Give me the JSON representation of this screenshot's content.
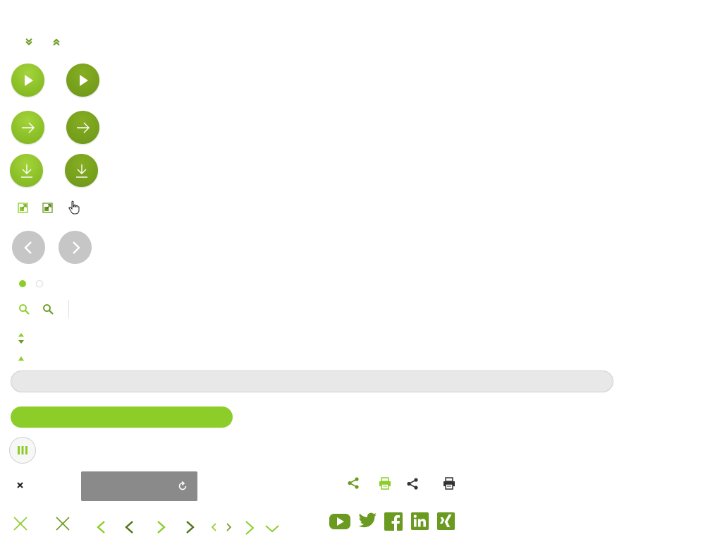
{
  "colors": {
    "brand_green": "#8ccd29",
    "dark_green": "#76a01c",
    "icon_green": "#6a9a1f",
    "grey_button": "#c6c6c6",
    "progress_track": "#e8e8e8",
    "grey_bar": "#8a8a8a"
  },
  "icons": {
    "row1": [
      "double-chevron-down-icon",
      "double-chevron-up-icon"
    ],
    "play_buttons": [
      "play-icon",
      "play-icon"
    ],
    "arrow_buttons": [
      "arrow-right-icon",
      "arrow-right-icon"
    ],
    "download_buttons": [
      "download-icon",
      "download-icon"
    ],
    "external": [
      "external-link-icon",
      "external-link-icon",
      "hand-cursor-icon"
    ],
    "carousel": [
      "chevron-left-icon",
      "chevron-right-icon"
    ],
    "search": [
      "search-icon",
      "search-icon"
    ],
    "sort": [
      "sort-icon",
      "sort-up-icon"
    ],
    "share_print": [
      "share-icon",
      "print-icon",
      "share-icon",
      "print-icon"
    ],
    "social": [
      "youtube-icon",
      "twitter-icon",
      "facebook-icon",
      "linkedin-icon",
      "xing-icon"
    ]
  },
  "progress": {
    "fill_fraction": 0.368
  },
  "carousel_dots": {
    "count": 2,
    "active_index": 0
  }
}
